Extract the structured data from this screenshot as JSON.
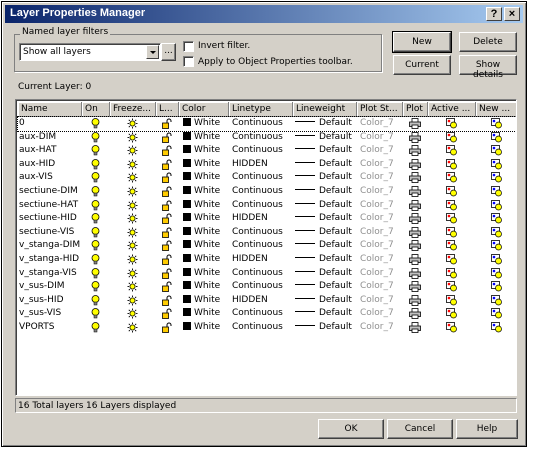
{
  "window": {
    "title": "Layer Properties Manager",
    "help_glyph": "?",
    "close_glyph": "×"
  },
  "filters": {
    "group_label": "Named layer filters",
    "selected": "Show all layers",
    "browse_label": "...",
    "invert_label": "Invert filter.",
    "apply_label": "Apply to Object Properties toolbar.",
    "invert_checked": false,
    "apply_checked": false
  },
  "buttons": {
    "new": "New",
    "delete": "Delete",
    "current": "Current",
    "show_details": "Show details",
    "ok": "OK",
    "cancel": "Cancel",
    "help": "Help"
  },
  "current_layer": "Current Layer:  0",
  "columns": [
    "Name",
    "On",
    "Freeze...",
    "L...",
    "Color",
    "Linetype",
    "Lineweight",
    "Plot St...",
    "Plot",
    "Active ...",
    "New ..."
  ],
  "layers": [
    {
      "name": "0",
      "color": "White",
      "linetype": "Continuous",
      "lineweight": "Default",
      "plot_style": "Color_7"
    },
    {
      "name": "aux-DIM",
      "color": "White",
      "linetype": "Continuous",
      "lineweight": "Default",
      "plot_style": "Color_7"
    },
    {
      "name": "aux-HAT",
      "color": "White",
      "linetype": "Continuous",
      "lineweight": "Default",
      "plot_style": "Color_7"
    },
    {
      "name": "aux-HID",
      "color": "White",
      "linetype": "HIDDEN",
      "lineweight": "Default",
      "plot_style": "Color_7"
    },
    {
      "name": "aux-VIS",
      "color": "White",
      "linetype": "Continuous",
      "lineweight": "Default",
      "plot_style": "Color_7"
    },
    {
      "name": "sectiune-DIM",
      "color": "White",
      "linetype": "Continuous",
      "lineweight": "Default",
      "plot_style": "Color_7"
    },
    {
      "name": "sectiune-HAT",
      "color": "White",
      "linetype": "Continuous",
      "lineweight": "Default",
      "plot_style": "Color_7"
    },
    {
      "name": "sectiune-HID",
      "color": "White",
      "linetype": "HIDDEN",
      "lineweight": "Default",
      "plot_style": "Color_7"
    },
    {
      "name": "sectiune-VIS",
      "color": "White",
      "linetype": "Continuous",
      "lineweight": "Default",
      "plot_style": "Color_7"
    },
    {
      "name": "v_stanga-DIM",
      "color": "White",
      "linetype": "Continuous",
      "lineweight": "Default",
      "plot_style": "Color_7"
    },
    {
      "name": "v_stanga-HID",
      "color": "White",
      "linetype": "HIDDEN",
      "lineweight": "Default",
      "plot_style": "Color_7"
    },
    {
      "name": "v_stanga-VIS",
      "color": "White",
      "linetype": "Continuous",
      "lineweight": "Default",
      "plot_style": "Color_7"
    },
    {
      "name": "v_sus-DIM",
      "color": "White",
      "linetype": "Continuous",
      "lineweight": "Default",
      "plot_style": "Color_7"
    },
    {
      "name": "v_sus-HID",
      "color": "White",
      "linetype": "HIDDEN",
      "lineweight": "Default",
      "plot_style": "Color_7"
    },
    {
      "name": "v_sus-VIS",
      "color": "White",
      "linetype": "Continuous",
      "lineweight": "Default",
      "plot_style": "Color_7"
    },
    {
      "name": "VPORTS",
      "color": "White",
      "linetype": "Continuous",
      "lineweight": "Default",
      "plot_style": "Color_7"
    }
  ],
  "status": {
    "total": "16 Total layers",
    "displayed": "16 Layers displayed"
  },
  "colors": {
    "title_start": "#0a246a",
    "title_end": "#a6caf0",
    "face": "#d4d0c8",
    "bulb": "#ffff00",
    "sun": "#ffff00",
    "lock": "#ffcc00"
  },
  "icons": [
    "lightbulb-on-icon",
    "sun-thawed-icon",
    "unlock-icon",
    "printer-icon",
    "viewport-freeze-icon",
    "new-viewport-freeze-icon"
  ]
}
